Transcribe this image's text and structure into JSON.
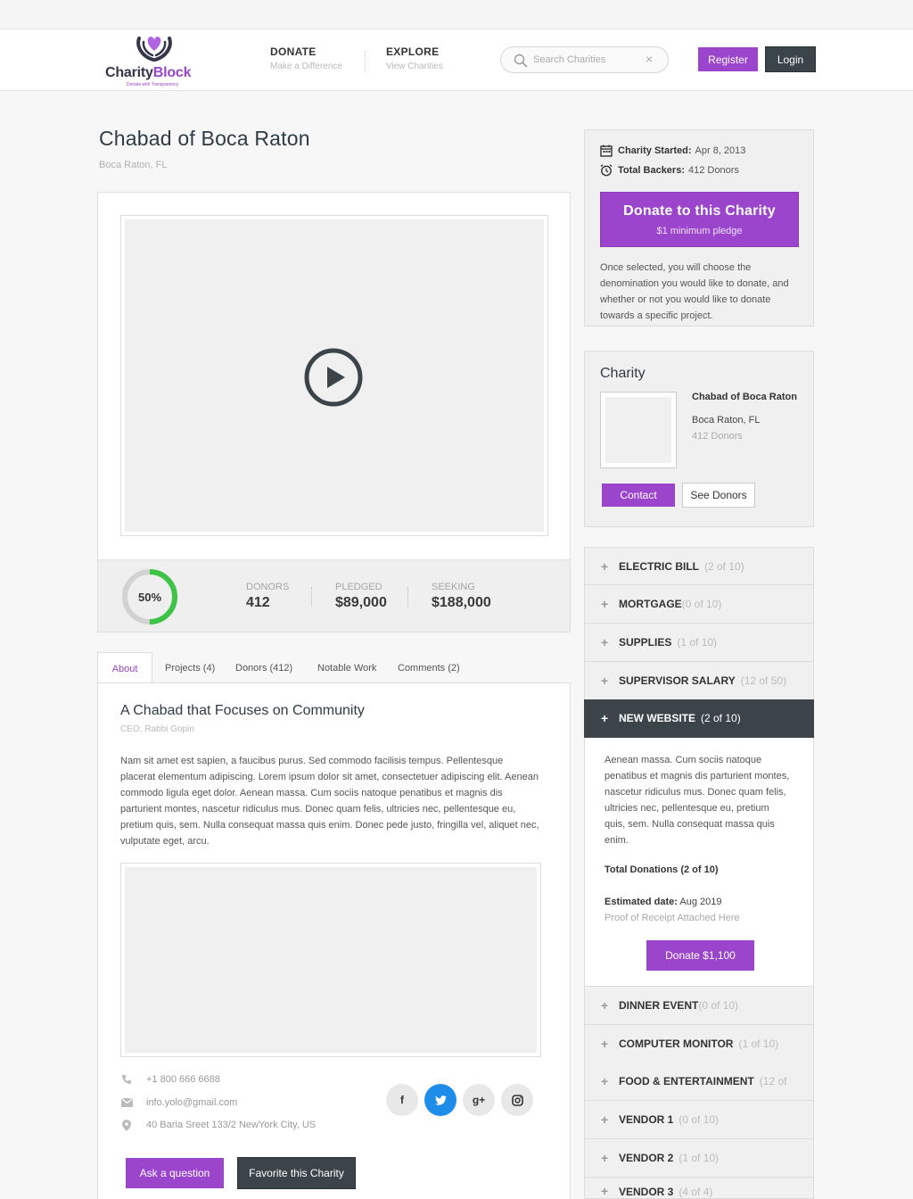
{
  "brand": {
    "name_part1": "Charity",
    "name_part2": "Block",
    "tagline": "Donate with Transparency"
  },
  "nav": [
    {
      "title": "DONATE",
      "subtitle": "Make a Difference"
    },
    {
      "title": "EXPLORE",
      "subtitle": "View Charities"
    }
  ],
  "search": {
    "placeholder": "Search Charities",
    "clear": "×"
  },
  "auth": {
    "register": "Register",
    "login": "Login"
  },
  "charity": {
    "name": "Chabad of Boca Raton",
    "location": "Boca Raton, FL"
  },
  "stats": {
    "progress_percent": 50,
    "progress_label": "50%",
    "donors_label": "DONORS",
    "donors_value": "412",
    "pledged_label": "PLEDGED",
    "pledged_value": "$89,000",
    "seeking_label": "SEEKING",
    "seeking_value": "$188,000"
  },
  "tabs": [
    "About",
    "Projects (4)",
    "Donors (412)",
    "Notable Work",
    "Comments (2)"
  ],
  "about": {
    "title": "A Chabad that Focuses on Community",
    "ceo": "CEO: Rabbi Gopin",
    "text": "Nam sit amet est sapien, a faucibus purus. Sed commodo facilisis tempus. Pellentesque placerat elementum adipiscing. Lorem ipsum dolor sit amet, consectetuer adipiscing elit. Aenean commodo ligula eget dolor. Aenean massa. Cum sociis natoque penatibus et magnis dis parturient montes, nascetur ridiculus mus. Donec quam felis, ultricies nec, pellentesque eu, pretium quis, sem. Nulla consequat massa quis enim. Donec pede justo, fringilla vel, aliquet nec, vulputate eget, arcu."
  },
  "contact_info": {
    "phone": "+1 800 666 6688",
    "email": "info.yolo@gmail.com",
    "address": "40 Baria Sreet 133/2 NewYork City, US"
  },
  "social": {
    "facebook": "f",
    "gplus": "g+"
  },
  "actions": {
    "ask": "Ask a question",
    "favorite": "Favorite this Charity"
  },
  "summary": {
    "started_label": "Charity Started:",
    "started_value": "Apr 8, 2013",
    "backers_label": "Total Backers:",
    "backers_value": "412 Donors",
    "donate_title": "Donate to this Charity",
    "donate_sub": "$1 minimum pledge",
    "note": "Once selected, you will choose the denomination you would like to donate, and whether or not you would like to donate towards a specific project."
  },
  "charity_card": {
    "heading": "Charity",
    "name": "Chabad of Boca Raton",
    "location": "Boca Raton, FL",
    "donors": "412 Donors",
    "contact": "Contact",
    "see_donors": "See Donors"
  },
  "projects": [
    {
      "name": "ELECTRIC BILL",
      "count": "(2 of 10)"
    },
    {
      "name": "MORTGAGE",
      "count": "(0 of 10)"
    },
    {
      "name": "SUPPLIES",
      "count": "(1 of 10)"
    },
    {
      "name": "SUPERVISOR SALARY",
      "count": "(12 of 50)"
    },
    {
      "name": "NEW WEBSITE",
      "count": "(2 of 10)"
    },
    {
      "name": "DINNER EVENT",
      "count": "(0 of 10)"
    },
    {
      "name": "COMPUTER MONITOR",
      "count": "(1 of 10)"
    },
    {
      "name": "FOOD & ENTERTAINMENT",
      "count": "(12 of"
    },
    {
      "name": "VENDOR 1",
      "count": "(0 of 10)"
    },
    {
      "name": "VENDOR 2",
      "count": "(1 of 10)"
    },
    {
      "name": "VENDOR 3",
      "count": "(4 of 4)"
    }
  ],
  "open_project": {
    "text": "Aenean massa. Cum sociis natoque penatibus et magnis dis parturient montes, nascetur ridiculus mus. Donec quam felis, ultricies nec, pellentesque eu, pretium quis, sem. Nulla consequat massa quis enim.",
    "total_label": "Total Donations (2 of 10)",
    "estimated_label": "Estimated date:",
    "estimated_value": "Aug 2019",
    "receipt": "Proof of Receipt Attached Here",
    "donate_button": "Donate $1,100"
  },
  "colors": {
    "accent": "#9b45cc",
    "dark": "#3b4449",
    "progress": "#3fc346",
    "twitter": "#1d8de9"
  }
}
